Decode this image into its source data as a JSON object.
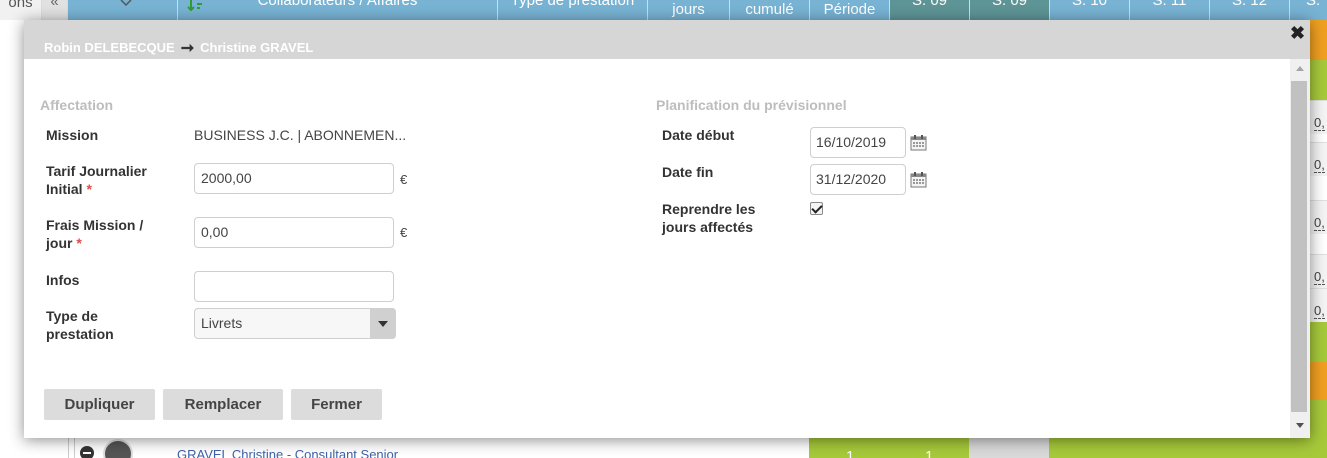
{
  "background": {
    "header": {
      "first": "ons",
      "chevron": "«",
      "filter_icon": "sort-icon",
      "collaborators": "Collaborateurs / Affaires",
      "type": "Type de prestation",
      "jours": "jours",
      "cumule": "cumulé",
      "periode": "Période",
      "weeks": [
        "S. 09",
        "S. 09",
        "S. 10",
        "S. 11",
        "S. 12",
        "S."
      ]
    },
    "right_values": [
      "0,",
      "0,",
      "0,",
      "0,",
      "0,",
      "0,"
    ],
    "row_name": "GRAVEL Christine - Consultant Senior",
    "row_numbers": [
      "1",
      "1"
    ],
    "colors": {
      "header": "#78b3d3",
      "week": "#5e9496",
      "green": "#a6c93a",
      "orange": "#f0a020"
    }
  },
  "modal": {
    "title_from": "Robin DELEBECQUE",
    "title_to": "Christine GRAVEL",
    "close": "✖",
    "affectation": {
      "title": "Affectation",
      "mission_label": "Mission",
      "mission_value": "BUSINESS J.C. | ABONNEMEN...",
      "tarif_label_1": "Tarif Journalier",
      "tarif_label_2": "Initial",
      "tarif_value": "2000,00",
      "frais_label_1": "Frais Mission /",
      "frais_label_2": "jour",
      "frais_value": "0,00",
      "currency": "€",
      "required_mark": "*",
      "infos_label": "Infos",
      "infos_value": "",
      "type_label_1": "Type de",
      "type_label_2": "prestation",
      "type_value": "Livrets"
    },
    "planification": {
      "title": "Planification du prévisionnel",
      "date_debut_label": "Date début",
      "date_debut_value": "16/10/2019",
      "date_fin_label": "Date fin",
      "date_fin_value": "31/12/2020",
      "reprendre_label_1": "Reprendre les",
      "reprendre_label_2": "jours affectés",
      "reprendre_checked": true
    },
    "buttons": {
      "dupliquer": "Dupliquer",
      "remplacer": "Remplacer",
      "fermer": "Fermer"
    }
  }
}
